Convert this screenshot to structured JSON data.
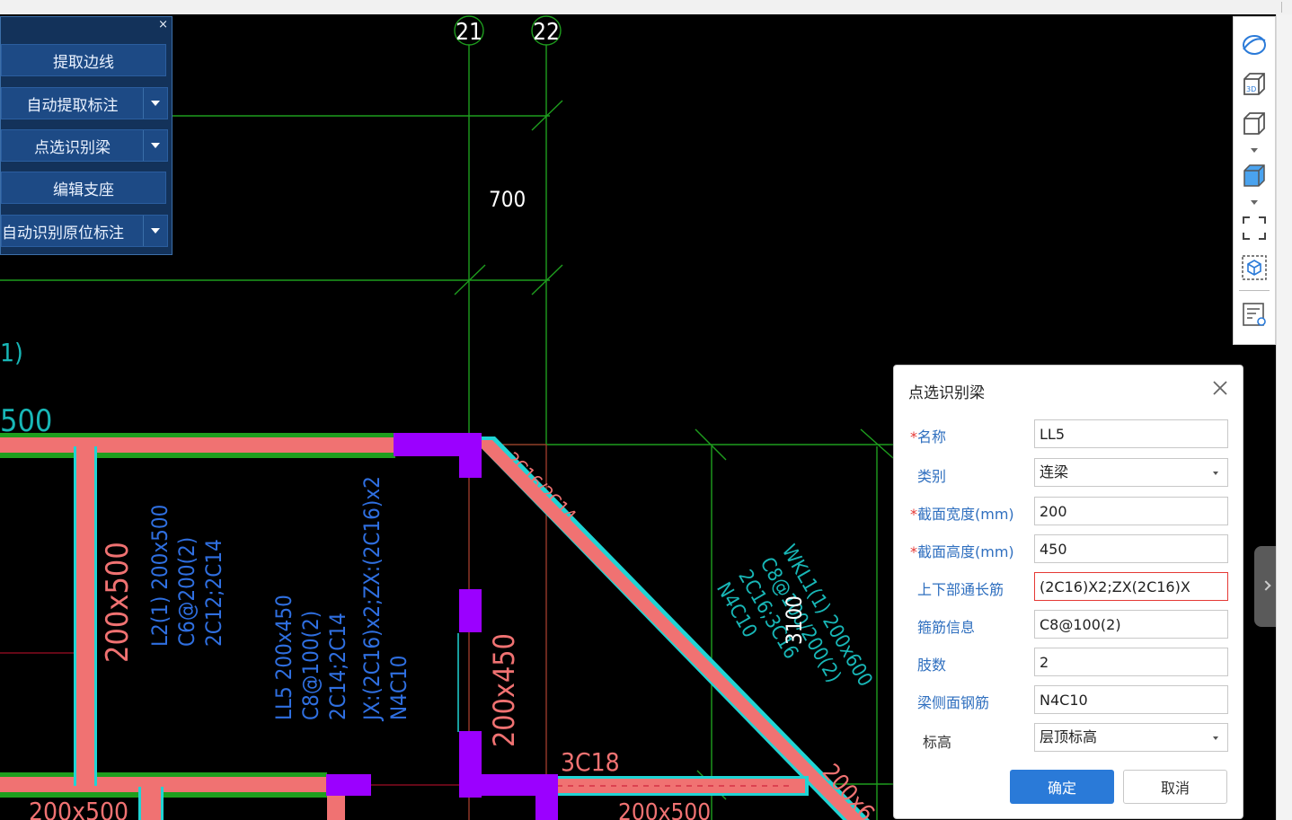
{
  "colors": {
    "background": "#000000",
    "gridline": "#1e9e1e",
    "beam_fill": "#f07272",
    "beam_edge": "#20d4d4",
    "support": "#9b00ff",
    "annotation_blue": "#2f6fe0",
    "annotation_teal": "#18b7b7",
    "annotation_red": "#f07272",
    "panel_bg": "#13325a",
    "panel_button": "#1d4a85",
    "dialog_label": "#2f6fbf",
    "primary_button": "#2a7ad8"
  },
  "tool_panel": {
    "close": "×",
    "buttons": [
      {
        "label": "提取边线",
        "has_dropdown": false
      },
      {
        "label": "自动提取标注",
        "has_dropdown": true
      },
      {
        "label": "点选识别梁",
        "has_dropdown": true
      },
      {
        "label": "编辑支座",
        "has_dropdown": false
      },
      {
        "label": "自动识别原位标注",
        "has_dropdown": true
      }
    ]
  },
  "right_toolbar": {
    "icons": [
      "orbit-icon",
      "view-3d-icon",
      "cube-wireframe-icon",
      "cube-solid-icon",
      "fit-view-icon",
      "select-box-icon",
      "properties-icon"
    ]
  },
  "cad": {
    "axis_labels": [
      "21",
      "22"
    ],
    "dim_700": "700",
    "dim_3100": "3100",
    "partial_1": "1)",
    "partial_500": "500",
    "beam_l2": [
      "L2(1) 200x500",
      "C6@200(2)",
      "2C12;2C14"
    ],
    "beam_ll5": [
      "LL5 200x450",
      "C8@100(2)",
      "2C14;2C14"
    ],
    "beam_jx": [
      "JX:(2C16)x2;ZX:(2C16)x2",
      "N4C10"
    ],
    "wkl1": [
      "WKL1(1) 200x600",
      "C8@100/200(2)",
      "2C16;3C16",
      "N4C10"
    ],
    "text_200x500_vertical": "200x500",
    "text_200x450_vertical": "200x450",
    "text_2c16": "2C16/2C14",
    "text_3c18": "3C18",
    "text_200x500_bottom_left": "200x500",
    "text_200x500_bottom_mid": "200x500",
    "text_200x6_bottom_right": "200x6"
  },
  "dialog": {
    "title": "点选识别梁",
    "fields": {
      "name": {
        "label": "名称",
        "required": true,
        "value": "LL5"
      },
      "type": {
        "label": "类别",
        "required": false,
        "value": "连梁"
      },
      "width": {
        "label": "截面宽度(mm)",
        "required": true,
        "value": "200"
      },
      "height": {
        "label": "截面高度(mm)",
        "required": true,
        "value": "450"
      },
      "top_bottom_rebar": {
        "label": "上下部通长筋",
        "required": false,
        "value": "(2C16)X2;ZX(2C16)X"
      },
      "stirrup": {
        "label": "箍筋信息",
        "required": false,
        "value": "C8@100(2)"
      },
      "legs": {
        "label": "肢数",
        "required": false,
        "value": "2"
      },
      "side_rebar": {
        "label": "梁侧面钢筋",
        "required": false,
        "value": "N4C10"
      },
      "elevation": {
        "label": "标高",
        "required": false,
        "value": "层顶标高"
      }
    },
    "ok_label": "确定",
    "cancel_label": "取消",
    "required_mark": "*"
  }
}
